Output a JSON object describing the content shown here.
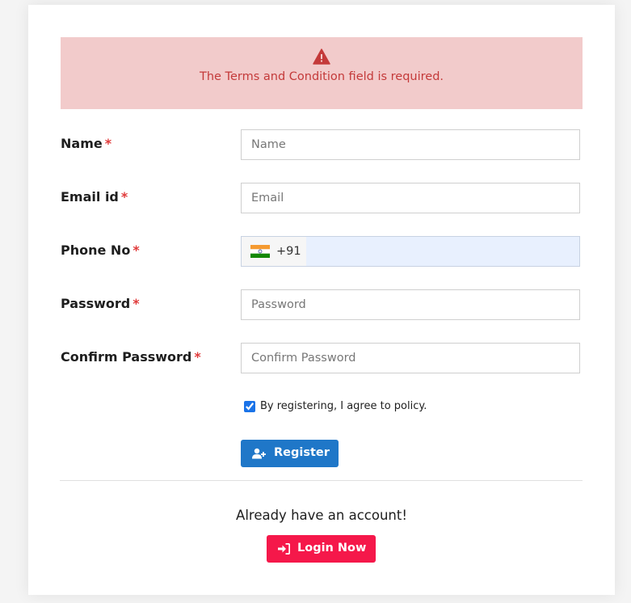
{
  "alert": {
    "icon": "warning-triangle-icon",
    "message": "The Terms and Condition field is required.",
    "background": "#f2cbcb",
    "color": "#c43a3a"
  },
  "form": {
    "name": {
      "label": "Name",
      "required": "*",
      "placeholder": "Name"
    },
    "email": {
      "label": "Email id",
      "required": "*",
      "placeholder": "Email"
    },
    "phone": {
      "label": "Phone No",
      "required": "*",
      "country_flag": "india-flag-icon",
      "dial_code": "+91"
    },
    "password": {
      "label": "Password",
      "required": "*",
      "placeholder": "Password"
    },
    "confirm_password": {
      "label": "Confirm Password",
      "required": "*",
      "placeholder": "Confirm Password"
    },
    "agree": {
      "label": "By registering, I agree to policy.",
      "checked": true
    },
    "register_button": {
      "label": "Register",
      "icon": "user-plus-icon",
      "color": "#1f77c8"
    }
  },
  "footer": {
    "prompt": "Already have an account!",
    "login_button": {
      "label": "Login Now",
      "icon": "sign-in-icon",
      "color": "#f5184a"
    }
  }
}
